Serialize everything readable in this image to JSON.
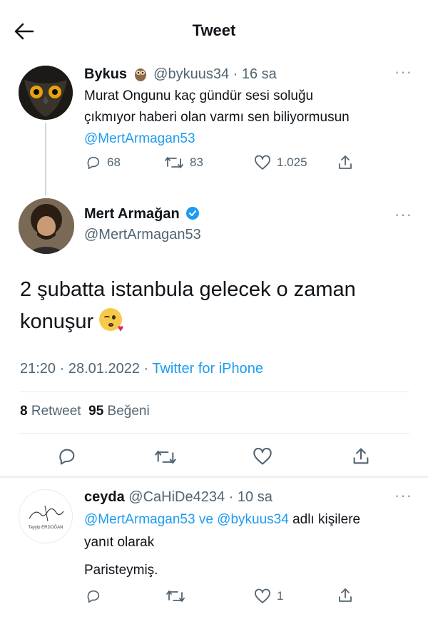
{
  "header": {
    "title": "Tweet",
    "back_icon": "arrow-left-icon"
  },
  "parent_tweet": {
    "name": "Bykus",
    "handle": "@bykuus34",
    "time": "· 16 sa",
    "text_line1": "Murat Ongunu kaç gündür sesi soluğu",
    "text_line2": "çıkmıyor haberi olan varmı sen biliyormusun",
    "mention": "@MertArmagan53",
    "replies": "68",
    "retweets": "83",
    "likes": "1.025"
  },
  "main_tweet": {
    "name": "Mert Armağan",
    "handle": "@MertArmagan53",
    "text_line1": "2 şubatta istanbula gelecek o zaman",
    "text_line2": "konuşur",
    "time": "21:20",
    "date": "· 28.01.2022 ·",
    "source": "Twitter for iPhone",
    "retweet_count": "8",
    "retweet_label": "Retweet",
    "like_count": "95",
    "like_label": "Beğeni"
  },
  "reply_tweet": {
    "name": "ceyda",
    "handle": "@CaHiDe4234",
    "time": "· 10 sa",
    "mention1": "@MertArmagan53",
    "connector": "ve",
    "mention2": "@bykuus34",
    "reply_suffix": "adlı kişilere",
    "reply_line2": "yanıt olarak",
    "text": "Paristeymiş.",
    "likes": "1",
    "avatar_caption": "Tayyip ERDOĞAN"
  },
  "colors": {
    "link": "#1d9bf0",
    "verified": "#1d9bf0",
    "secondary_text": "#536471"
  }
}
